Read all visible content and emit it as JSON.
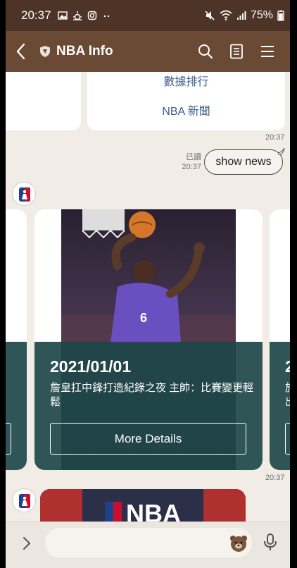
{
  "status_bar": {
    "time": "20:37",
    "battery_percent": "75%",
    "left_icons": [
      "image-icon",
      "weather-icon",
      "instagram-icon",
      "more-dots-icon"
    ],
    "right_icons": [
      "mute-icon",
      "wifi-icon",
      "signal-icon",
      "battery-icon"
    ]
  },
  "app_bar": {
    "title": "NBA Info",
    "actions": [
      "search-icon",
      "notes-icon",
      "menu-icon"
    ]
  },
  "chat": {
    "menu_items": [
      "數據排行",
      "NBA 新聞"
    ],
    "timestamp_1": "20:37",
    "user_message": {
      "text": "show news",
      "read_label": "已讀",
      "time": "20:37"
    },
    "news_card": {
      "date": "2021/01/01",
      "headline": "詹皇扛中鋒打造紀錄之夜 主帥：比賽變更輕鬆",
      "button_label": "More Details"
    },
    "next_card_peek": {
      "date_fragment": "2",
      "text_fragment": "於\n出"
    },
    "timestamp_2": "20:37",
    "bottom_card_label": "NBA"
  },
  "input_bar": {
    "placeholder": ""
  },
  "colors": {
    "status_bar_bg": "#4e3426",
    "app_bar_bg": "#6b4a35",
    "chat_bg": "#f1ece6",
    "card_panel": "#1e4648",
    "link_text": "#3e5f8a"
  }
}
